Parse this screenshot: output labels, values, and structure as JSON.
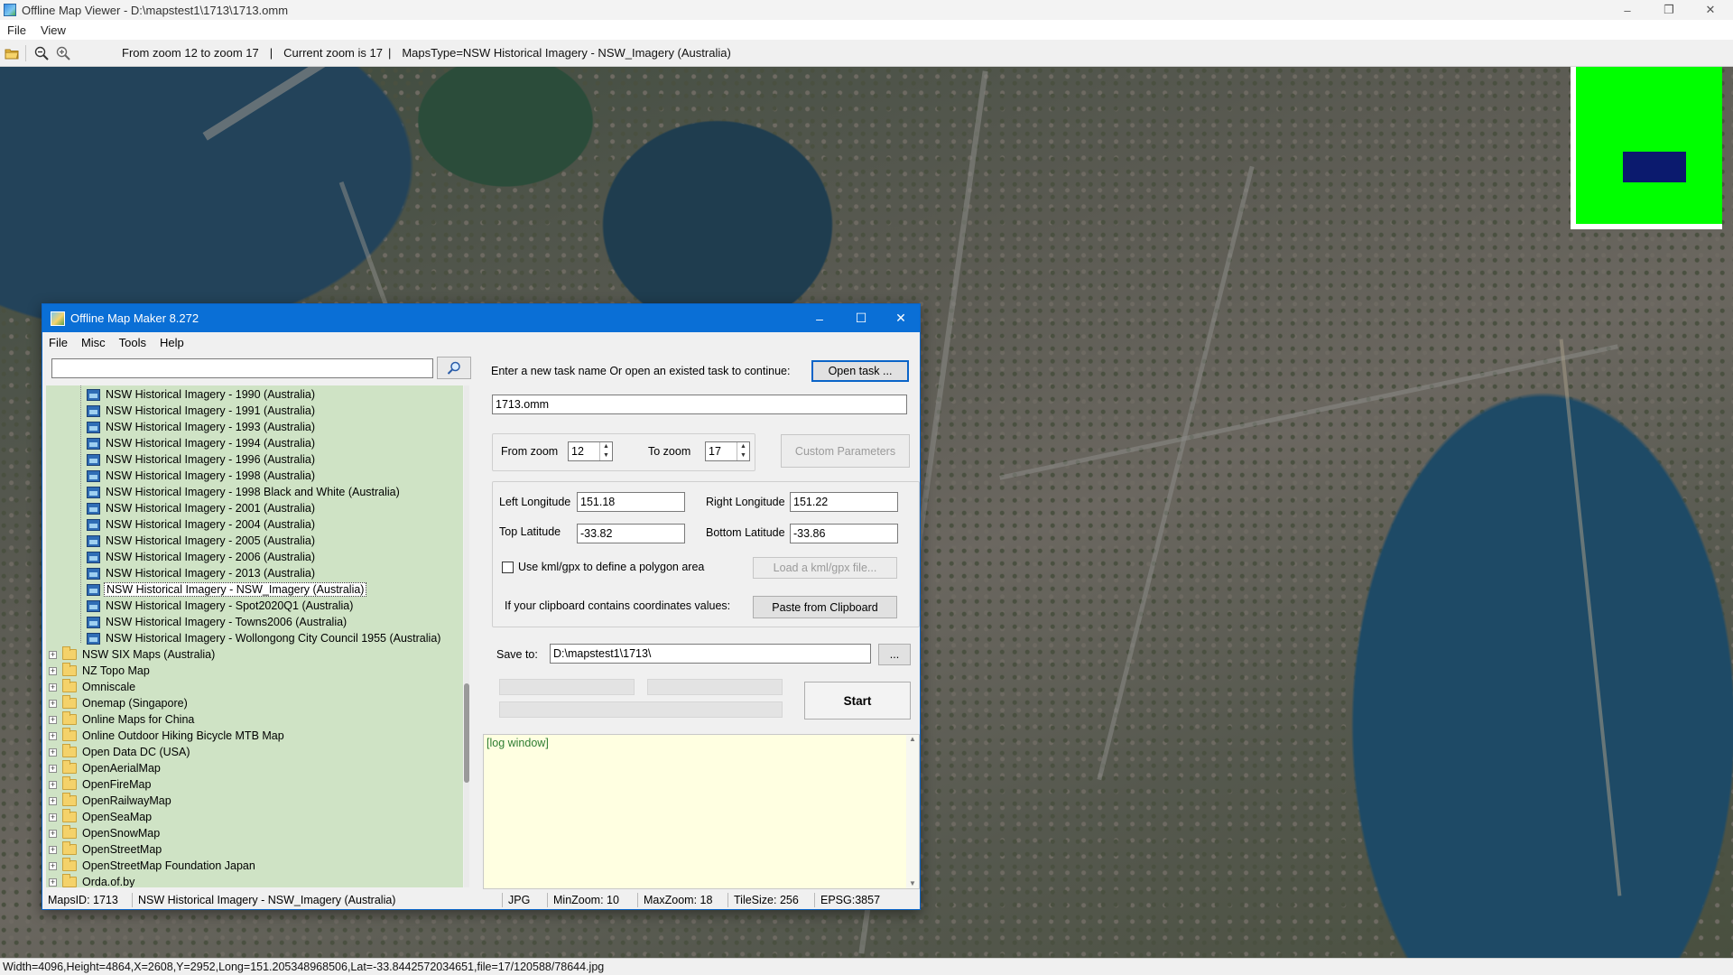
{
  "window": {
    "title": "Offline Map Viewer - D:\\mapstest1\\1713\\1713.omm",
    "menu": [
      "File",
      "View"
    ],
    "controls": {
      "minimize": "–",
      "maximize": "❐",
      "close": "✕"
    }
  },
  "toolbar": {
    "zoom_range": "From zoom 12 to zoom 17",
    "sep1": "|",
    "current_zoom": "Current zoom is 17",
    "sep2": "|",
    "maps_type": "MapsType=NSW Historical Imagery - NSW_Imagery (Australia)"
  },
  "statusbar": {
    "text": "Width=4096,Height=4864,X=2608,Y=2952,Long=151.205348968506,Lat=-33.8442572034651,file=17/120588/78644.jpg"
  },
  "minimap": {
    "background": "#00ff00",
    "viewport_color": "#0b1a6e"
  },
  "dialog": {
    "title": "Offline Map Maker 8.272",
    "menu": [
      "File",
      "Misc",
      "Tools",
      "Help"
    ],
    "controls": {
      "minimize": "–",
      "maximize": "☐",
      "close": "✕"
    },
    "search": {
      "value": ""
    },
    "tree": {
      "children": [
        {
          "label": "NSW Historical Imagery - 1990 (Australia)",
          "selected": false
        },
        {
          "label": "NSW Historical Imagery - 1991 (Australia)",
          "selected": false
        },
        {
          "label": "NSW Historical Imagery - 1993 (Australia)",
          "selected": false
        },
        {
          "label": "NSW Historical Imagery - 1994 (Australia)",
          "selected": false
        },
        {
          "label": "NSW Historical Imagery - 1996 (Australia)",
          "selected": false
        },
        {
          "label": "NSW Historical Imagery - 1998 (Australia)",
          "selected": false
        },
        {
          "label": "NSW Historical Imagery - 1998 Black and White (Australia)",
          "selected": false
        },
        {
          "label": "NSW Historical Imagery - 2001 (Australia)",
          "selected": false
        },
        {
          "label": "NSW Historical Imagery - 2004 (Australia)",
          "selected": false
        },
        {
          "label": "NSW Historical Imagery - 2005 (Australia)",
          "selected": false
        },
        {
          "label": "NSW Historical Imagery - 2006 (Australia)",
          "selected": false
        },
        {
          "label": "NSW Historical Imagery - 2013 (Australia)",
          "selected": false
        },
        {
          "label": "NSW Historical Imagery - NSW_Imagery (Australia)",
          "selected": true
        },
        {
          "label": "NSW Historical Imagery - Spot2020Q1 (Australia)",
          "selected": false
        },
        {
          "label": "NSW Historical Imagery - Towns2006 (Australia)",
          "selected": false
        },
        {
          "label": "NSW Historical Imagery - Wollongong City Council 1955 (Australia)",
          "selected": false
        }
      ],
      "folders": [
        "NSW SIX Maps (Australia)",
        "NZ Topo Map",
        "Omniscale",
        "Onemap (Singapore)",
        "Online Maps for China",
        "Online Outdoor Hiking Bicycle MTB Map",
        "Open Data DC (USA)",
        "OpenAerialMap",
        "OpenFireMap",
        "OpenRailwayMap",
        "OpenSeaMap",
        "OpenSnowMap",
        "OpenStreetMap",
        "OpenStreetMap Foundation Japan",
        "Orda.of.by"
      ],
      "expand_glyph": "+"
    },
    "task": {
      "prompt": "Enter a new task name Or open an existed task to continue:",
      "open_button": "Open task ...",
      "name_value": "1713.omm"
    },
    "zoom": {
      "from_label": "From zoom",
      "from_value": "12",
      "to_label": "To zoom",
      "to_value": "17",
      "custom_button": "Custom Parameters"
    },
    "bounds": {
      "left_lon_label": "Left Longitude",
      "left_lon_value": "151.18",
      "right_lon_label": "Right Longitude",
      "right_lon_value": "151.22",
      "top_lat_label": "Top Latitude",
      "top_lat_value": "-33.82",
      "bottom_lat_label": "Bottom Latitude",
      "bottom_lat_value": "-33.86",
      "kml_checkbox_label": "Use kml/gpx to define a polygon area",
      "kml_checked": false,
      "load_kml_button": "Load a kml/gpx file...",
      "clipboard_label": "If your clipboard contains coordinates values:",
      "paste_button": "Paste from Clipboard"
    },
    "save": {
      "label": "Save to:",
      "value": "D:\\mapstest1\\1713\\",
      "browse_button": "..."
    },
    "start_button": "Start",
    "log": {
      "text": "[log window]"
    },
    "status": {
      "maps_id": "MapsID: 1713",
      "map_name": "NSW Historical Imagery - NSW_Imagery (Australia)",
      "format": "JPG",
      "min_zoom": "MinZoom: 10",
      "max_zoom": "MaxZoom: 18",
      "tile_size": "TileSize: 256",
      "epsg": "EPSG:3857"
    }
  }
}
